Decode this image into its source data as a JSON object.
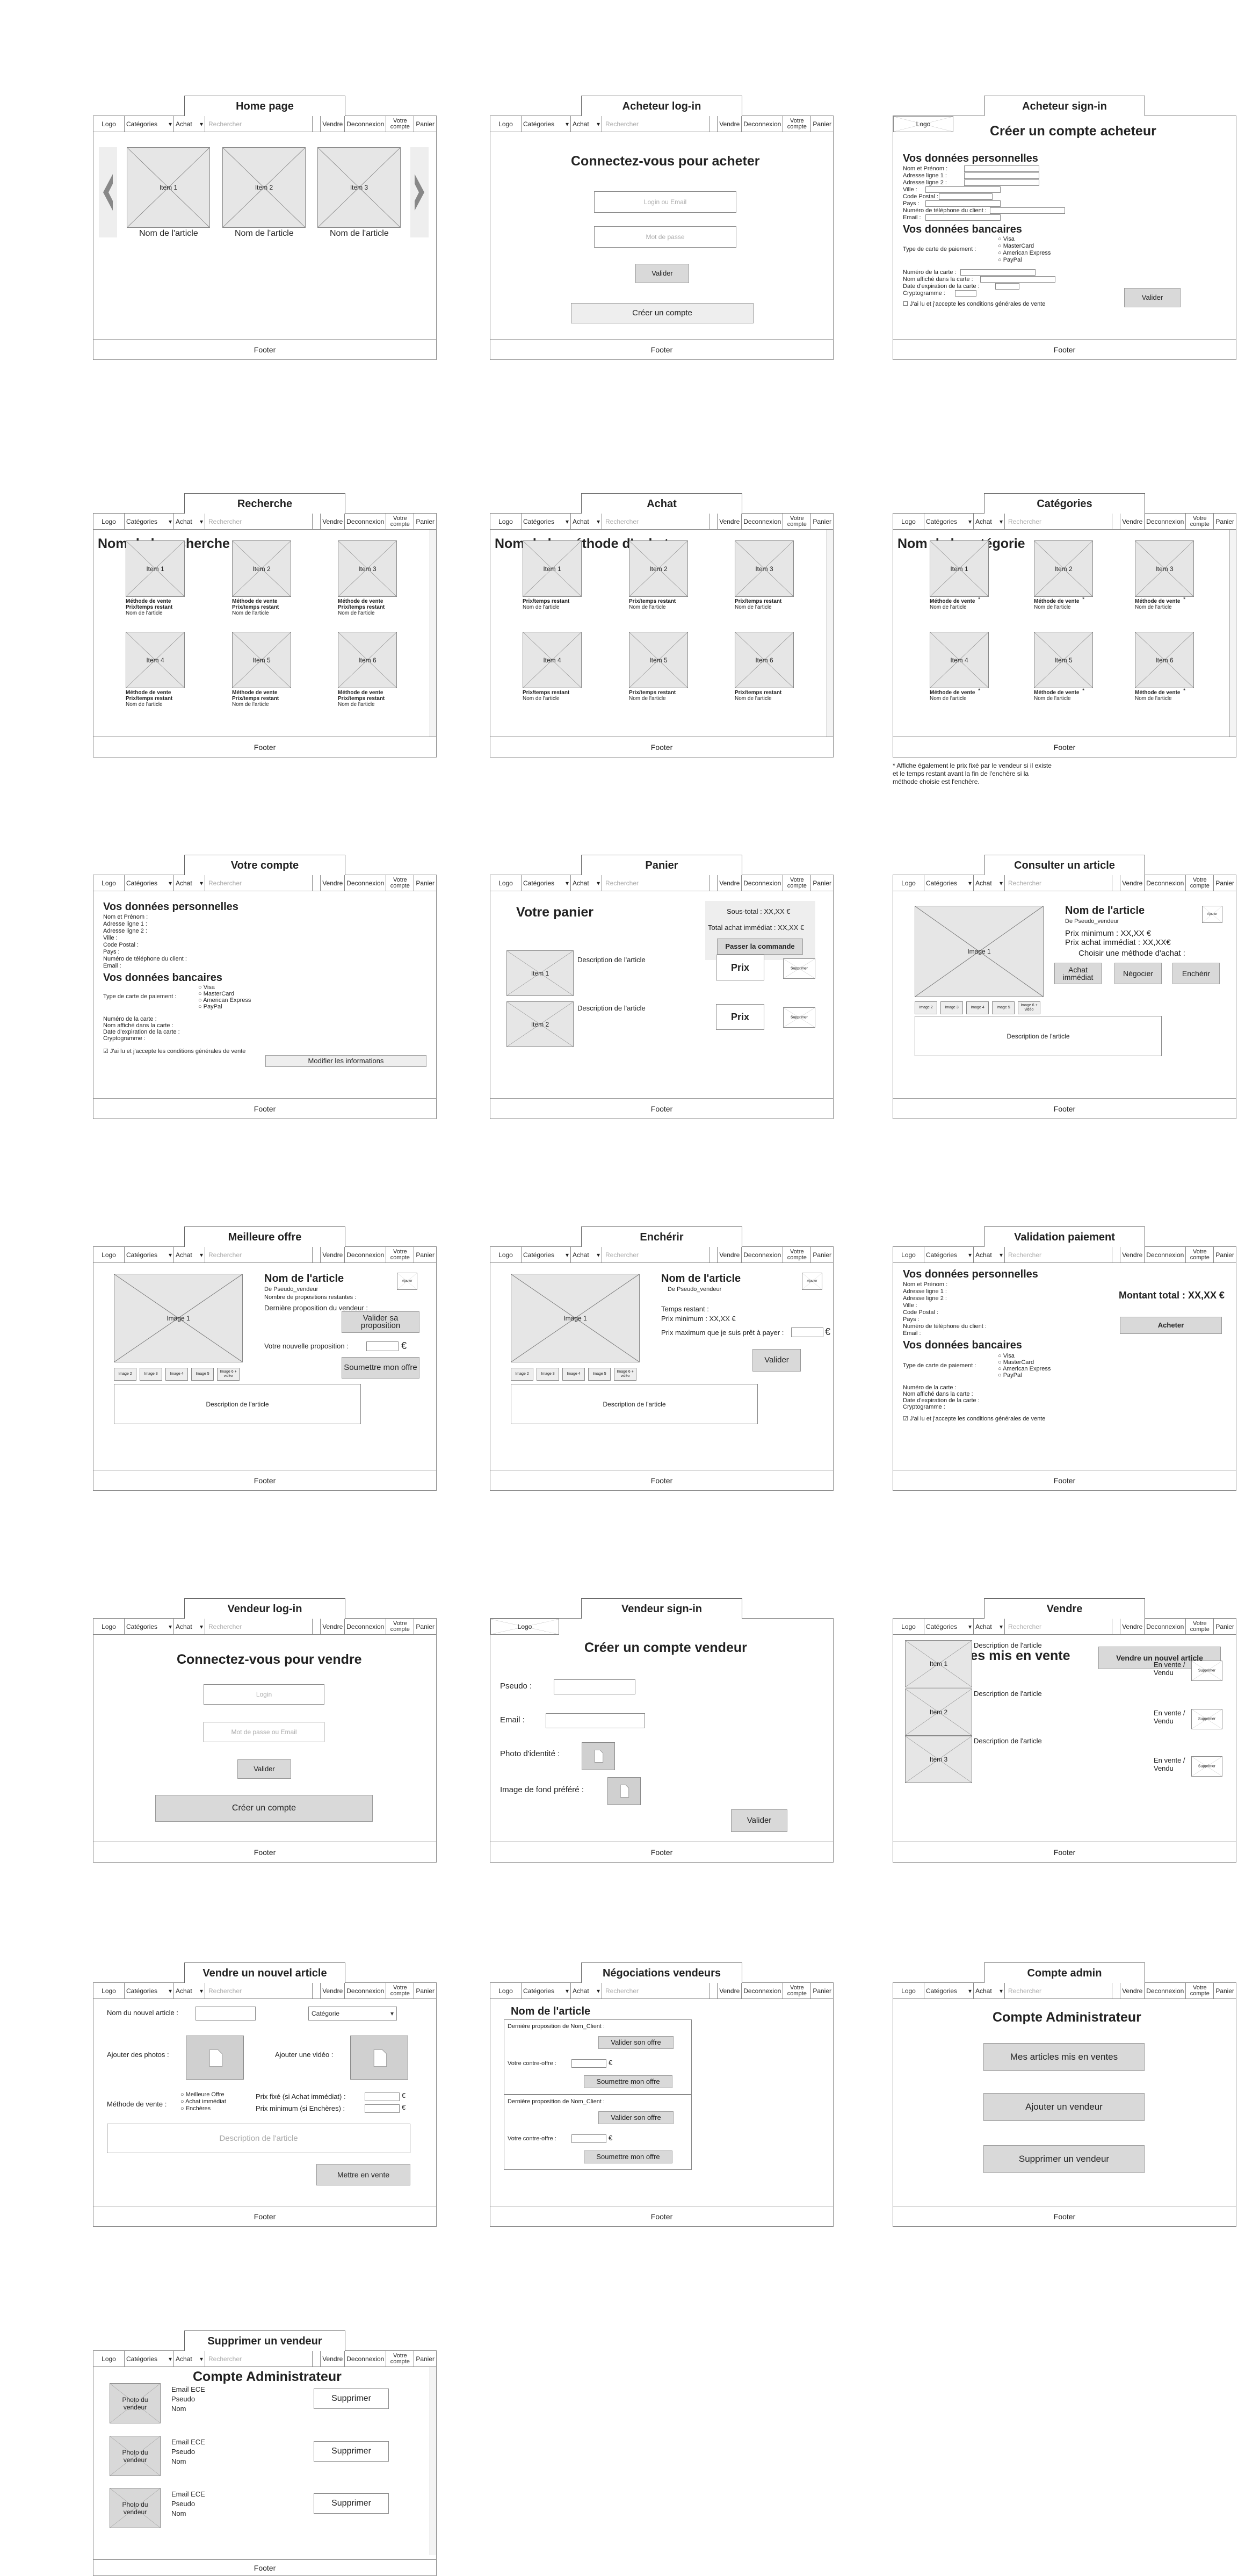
{
  "nav": {
    "logo": "Logo",
    "categories": "Catégories",
    "achat": "Achat",
    "search": "Rechercher",
    "vendre": "Vendre",
    "deconnexion": "Deconnexion",
    "compte": "Votre compte",
    "panier": "Panier"
  },
  "footer": "Footer",
  "frames": {
    "home": "Home page",
    "acheteur_login": "Acheteur log-in",
    "acheteur_signin": "Acheteur sign-in",
    "recherche": "Recherche",
    "achat": "Achat",
    "categories": "Catégories",
    "compte": "Votre compte",
    "panier": "Panier",
    "consulter": "Consulter un article",
    "meilleure": "Meilleure offre",
    "encherir": "Enchérir",
    "validation": "Validation paiement",
    "vendeur_login": "Vendeur log-in",
    "vendeur_signin": "Vendeur sign-in",
    "vendre": "Vendre",
    "nouvel": "Vendre un nouvel article",
    "nego": "Négociations vendeurs",
    "admin": "Compte admin",
    "supprimer": "Supprimer un vendeur"
  },
  "home": {
    "items": [
      "Item 1",
      "Item 2",
      "Item 3"
    ],
    "caption": "Nom de l'article"
  },
  "acheteur_login": {
    "heading": "Connectez-vous pour acheter",
    "login": "Login ou Email",
    "mdp": "Mot de passe",
    "valider": "Valider",
    "creer": "Créer un compte"
  },
  "signin": {
    "heading": "Créer un compte acheteur",
    "perso": "Vos données personnelles",
    "bancaire": "Vos données bancaires",
    "fields": [
      "Nom et Prénom :",
      "Adresse ligne 1 :",
      "Adresse ligne 2 :",
      "Ville :",
      "Code Postal :",
      "Pays :",
      "Numéro de téléphone du client :",
      "Email :"
    ],
    "type_carte": "Type de carte de paiement :",
    "cartes": [
      "Visa",
      "MasterCard",
      "American Express",
      "PayPal"
    ],
    "bank_fields": [
      "Numéro de la carte :",
      "Nom affiché dans la carte :",
      "Date d'expiration de la carte :",
      "Cryptogramme :"
    ],
    "cgv": "J'ai lu et j'accepte les conditions générales de vente",
    "valider": "Valider"
  },
  "recherche": {
    "heading": "Nom de la recherche",
    "items": [
      "Item 1",
      "Item 2",
      "Item 3",
      "Item 4",
      "Item 5",
      "Item 6"
    ],
    "l1": "Méthode de vente",
    "l2": "Prix/temps restant",
    "l3": "Nom de l'article"
  },
  "achat": {
    "heading": "Nom de la méthode d'achat",
    "l1": "Prix/temps restant",
    "l2": "Nom de l'article"
  },
  "categories": {
    "heading": "Nom de la catégorie",
    "l1": "Méthode de vente",
    "l2": "Nom de l'article",
    "note": "* Affiche également le prix fixé par le vendeur si il existe et le temps restant avant la fin de l'enchère si la méthode choisie est l'enchère."
  },
  "compte": {
    "modifier": "Modifier les informations",
    "cgv": "J'ai lu et j'accepte les conditions générales de vente"
  },
  "panier": {
    "heading": "Votre panier",
    "sous_total": "Sous-total : XX,XX €",
    "total": "Total achat immédiat : XX,XX €",
    "passer": "Passer la commande",
    "desc": "Description de l'article",
    "prix": "Prix",
    "supprimer": "Supprimer",
    "items": [
      "Item 1",
      "Item 2"
    ]
  },
  "consulter": {
    "nom": "Nom de l'article",
    "pseudo": "De Pseudo_vendeur",
    "prix_min": "Prix minimum : XX,XX €",
    "prix_achat": "Prix achat immédiat : XX,XX€",
    "choisir": "Choisir une méthode d'achat :",
    "achat_imm": "Achat immédiat",
    "negocier": "Négocier",
    "encherir": "Enchérir",
    "image": "Image 1",
    "desc": "Description de l'article",
    "thumbs": [
      "Image 2",
      "Image 3",
      "Image 4",
      "Image 5",
      "Image 6 + vidéo"
    ],
    "ajouter": "Ajouter"
  },
  "meilleure": {
    "nom": "Nom de l'article",
    "pseudo": "De Pseudo_vendeur",
    "nb": "Nombre de propositions restantes :",
    "derniere": "Dernière proposition du vendeur :",
    "valider": "Valider sa proposition",
    "votre": "Votre nouvelle proposition :",
    "soumettre": "Soumettre mon offre",
    "euro": "€"
  },
  "encherir": {
    "temps": "Temps restant :",
    "prix_min": "Prix minimum : XX,XX €",
    "prix_max": "Prix maximum que je suis prêt à payer :",
    "valider": "Valider"
  },
  "validation": {
    "montant": "Montant total : XX,XX €",
    "acheter": "Acheter"
  },
  "vendeur_login": {
    "heading": "Connectez-vous pour vendre",
    "login": "Login",
    "mdp": "Mot de passe ou Email",
    "valider": "Valider",
    "creer": "Créer un compte"
  },
  "vendeur_signin": {
    "heading": "Créer un compte vendeur",
    "pseudo": "Pseudo :",
    "email": "Email :",
    "photo": "Photo d'identité :",
    "fond": "Image de fond préféré :",
    "valider": "Valider"
  },
  "vendre": {
    "heading": "Mes articles mis en vente",
    "nouvel": "Vendre un nouvel article",
    "desc": "Description de l'article",
    "statut": "En vente / Vendu",
    "items": [
      "Item 1",
      "Item 2",
      "Item 3"
    ]
  },
  "nouvel": {
    "nom": "Nom du nouvel article :",
    "categorie": "Catégorie",
    "photos": "Ajouter des photos :",
    "video": "Ajouter une vidéo :",
    "methode": "Méthode de vente :",
    "methodes": [
      "Meilleure Offre",
      "Achat immédiat",
      "Enchères"
    ],
    "prix_fixe": "Prix fixé (si Achat immédiat) :",
    "prix_min": "Prix minimum (si Enchères) :",
    "desc": "Description de l'article",
    "mettre": "Mettre en vente"
  },
  "nego": {
    "nom": "Nom de l'article",
    "derniere": "Dernière proposition de Nom_Client :",
    "valider": "Valider son offre",
    "contre": "Votre contre-offre :",
    "soumettre": "Soumettre mon offre"
  },
  "admin": {
    "heading": "Compte Administrateur",
    "b1": "Mes articles mis en ventes",
    "b2": "Ajouter un vendeur",
    "b3": "Supprimer un vendeur"
  },
  "supprimer": {
    "photo": "Photo du vendeur",
    "email": "Email ECE",
    "pseudo": "Pseudo",
    "nom": "Nom",
    "btn": "Supprimer"
  }
}
